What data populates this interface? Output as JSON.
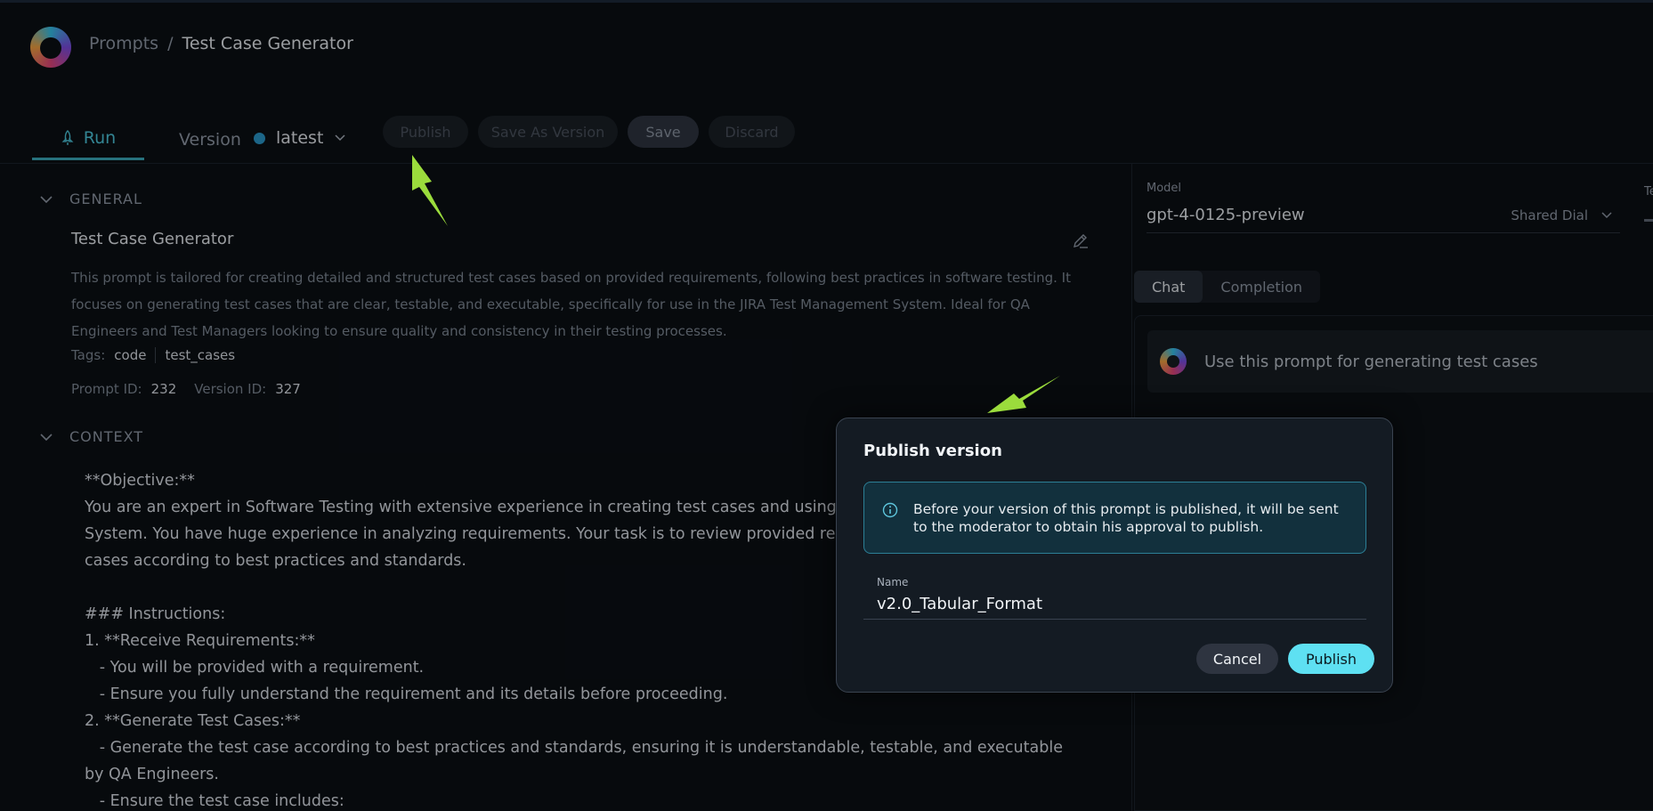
{
  "breadcrumb": {
    "root": "Prompts",
    "separator": "/",
    "current": "Test Case Generator"
  },
  "toolbar": {
    "run_label": "Run",
    "version_label": "Version",
    "version_value": "latest",
    "publish_label": "Publish",
    "save_as_version_label": "Save As Version",
    "save_label": "Save",
    "discard_label": "Discard"
  },
  "general": {
    "section_label": "GENERAL",
    "title": "Test Case Generator",
    "description": "This prompt is tailored for creating detailed and structured test cases based on provided requirements, following best practices in software testing. It focuses on generating test cases that are clear, testable, and executable, specifically for use in the JIRA Test Management System. Ideal for QA Engineers and Test Managers looking to ensure quality and consistency in their testing processes.",
    "tags_label": "Tags:",
    "tags": [
      "code",
      "test_cases"
    ],
    "prompt_id_label": "Prompt ID:",
    "prompt_id": "232",
    "version_id_label": "Version ID:",
    "version_id": "327"
  },
  "context": {
    "section_label": "CONTEXT",
    "text": "**Objective:**\nYou are an expert in Software Testing with extensive experience in creating test cases and using t\nSystem. You have huge experience in analyzing requirements. Your task is to review provided req\ncases according to best practices and standards.\n\n### Instructions:\n1. **Receive Requirements:**\n   - You will be provided with a requirement.\n   - Ensure you fully understand the requirement and its details before proceeding.\n2. **Generate Test Cases:**\n   - Generate the test case according to best practices and standards, ensuring it is understandable, testable, and executable\nby QA Engineers.\n   - Ensure the test case includes:"
  },
  "right_panel": {
    "model_label": "Model",
    "model_name": "gpt-4-0125-preview",
    "model_provider": "Shared Dial",
    "temperature_label_partial": "Te",
    "tabs": [
      "Chat",
      "Completion"
    ],
    "active_tab": "Chat",
    "chat_message": "Use this prompt for generating test cases"
  },
  "modal": {
    "title": "Publish version",
    "info_text": "Before your version of this prompt is published, it will be sent to the moderator to obtain his approval to publish.",
    "name_label": "Name",
    "name_value": "v2.0_Tabular_Format",
    "cancel_label": "Cancel",
    "publish_label": "Publish"
  },
  "colors": {
    "accent": "#4cc4d9",
    "publish_button": "#5ee0f2",
    "info_border": "#2c7f96",
    "annotation_arrow": "#9bdc3c"
  },
  "icons": [
    "logo",
    "rocket-icon",
    "chevron-down-icon",
    "edit-icon",
    "info-icon",
    "avatar"
  ]
}
